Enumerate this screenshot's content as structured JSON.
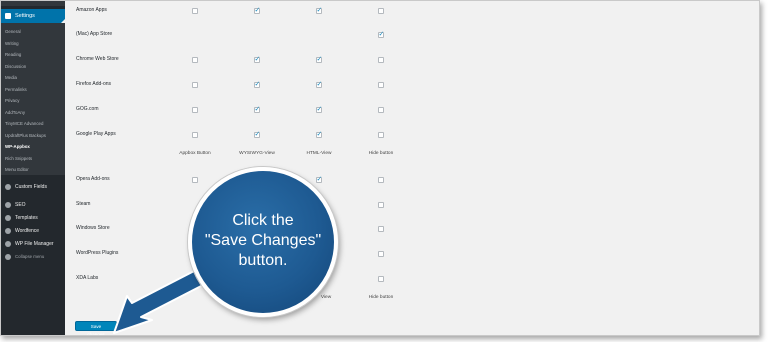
{
  "sidebar": {
    "settings_label": "Settings",
    "submenu": [
      "General",
      "Writing",
      "Reading",
      "Discussion",
      "Media",
      "Permalinks",
      "Privacy",
      "AddToAny",
      "TinyMCE Advanced",
      "UpdraftPlus Backups",
      "WP-Appbox",
      "Rich Snippets",
      "Menu Editor"
    ],
    "current_item": "WP-Appbox",
    "main_items": [
      {
        "label": "Custom Fields",
        "icon": "custom-fields-icon"
      },
      {
        "label": "SEO",
        "icon": "seo-icon"
      },
      {
        "label": "Templates",
        "icon": "templates-icon"
      },
      {
        "label": "Wordfence",
        "icon": "wordfence-icon"
      },
      {
        "label": "WP File Manager",
        "icon": "file-manager-icon"
      }
    ],
    "collapse_label": "Collapse menu"
  },
  "table": {
    "column_headers": [
      "Appbox Button",
      "WYSIWYG-View",
      "HTML-View",
      "Hide button"
    ],
    "rows_top": [
      {
        "label": "Amazon Apps",
        "checks": [
          false,
          true,
          true,
          false
        ]
      },
      {
        "label": "(Mac) App Store",
        "checks": [
          null,
          null,
          null,
          true
        ]
      },
      {
        "label": "Chrome Web Store",
        "checks": [
          false,
          true,
          true,
          false
        ]
      },
      {
        "label": "Firefox Add-ons",
        "checks": [
          false,
          true,
          true,
          false
        ]
      },
      {
        "label": "GOG.com",
        "checks": [
          false,
          true,
          true,
          false
        ]
      },
      {
        "label": "Google Play Apps",
        "checks": [
          false,
          true,
          true,
          false
        ]
      }
    ],
    "rows_bottom": [
      {
        "label": "Opera Add-ons",
        "checks": [
          false,
          null,
          true,
          false
        ]
      },
      {
        "label": "Steam",
        "checks": [
          null,
          null,
          null,
          false
        ]
      },
      {
        "label": "Windows Store",
        "checks": [
          null,
          null,
          null,
          false
        ]
      },
      {
        "label": "WordPress Plugins",
        "checks": [
          null,
          null,
          null,
          false
        ]
      },
      {
        "label": "XDA Labs",
        "checks": [
          null,
          null,
          null,
          false
        ]
      }
    ],
    "footer_headers": [
      "View",
      "Hide button"
    ]
  },
  "save_button_label": "Save changes",
  "callout": {
    "line1": "Click the",
    "line2": "\"Save Changes\"",
    "line3": "button."
  },
  "colors": {
    "accent": "#0073aa",
    "button": "#0085ba",
    "bubble": "#1e5a92",
    "sidebar": "#23282d"
  }
}
